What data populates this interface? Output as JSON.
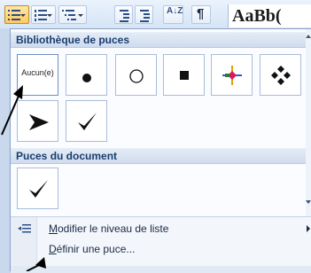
{
  "ribbon": {
    "style_preview_text": "AaBb(",
    "pilcrow_glyph": "¶",
    "sort_glyph": "A↓Z"
  },
  "panel": {
    "library_title": "Bibliothèque de puces",
    "document_title": "Puces du document",
    "none_label": "Aucun(e)"
  },
  "menu": {
    "change_level_accel": "M",
    "change_level_rest": "odifier le niveau de liste",
    "define_bullet_accel": "D",
    "define_bullet_rest": "éfinir une puce..."
  },
  "icons": [
    "bullets-list-icon",
    "numbering-icon",
    "multilevel-list-icon",
    "decrease-indent-icon",
    "increase-indent-icon",
    "sort-icon",
    "show-formatting-icon",
    "filled-circle-bullet-icon",
    "hollow-circle-bullet-icon",
    "square-bullet-icon",
    "colored-star-bullet-icon",
    "diamond-cluster-bullet-icon",
    "arrowhead-bullet-icon",
    "checkmark-bullet-icon",
    "list-level-icon"
  ]
}
